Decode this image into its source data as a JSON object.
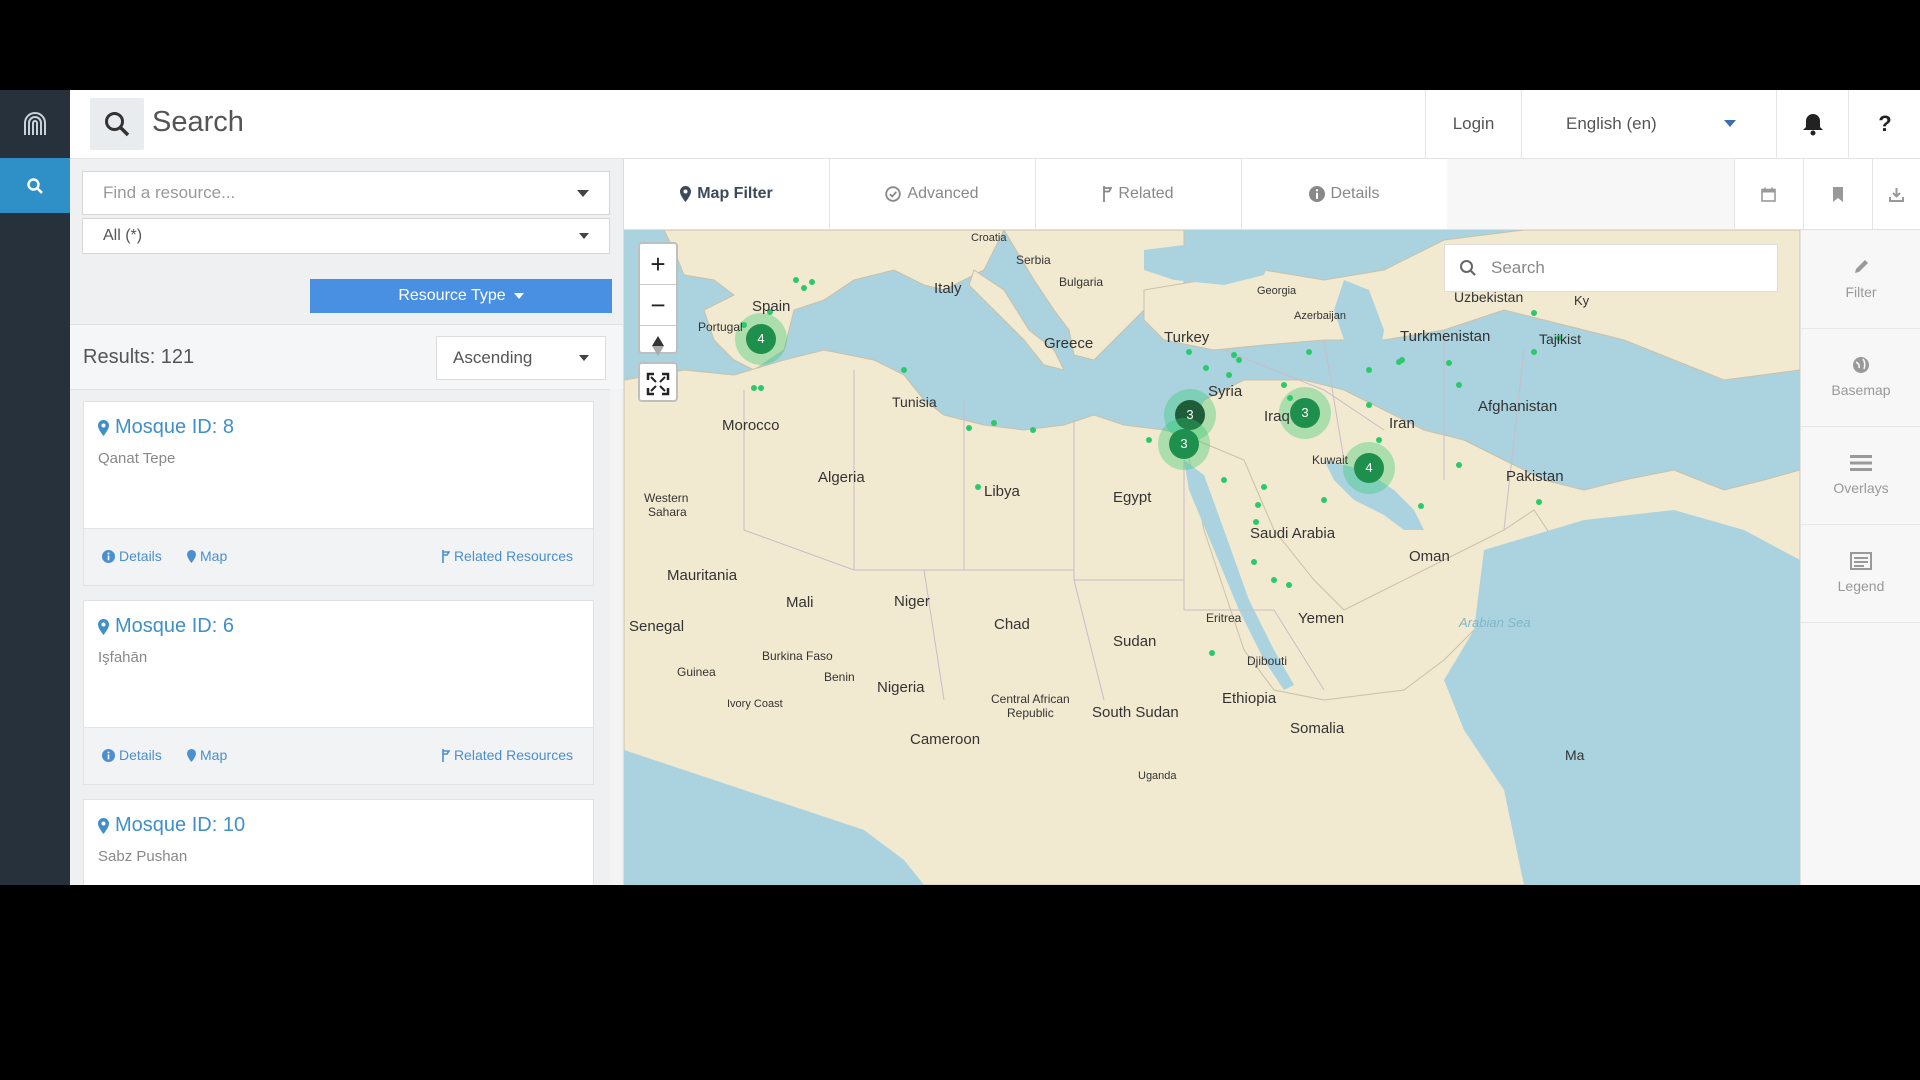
{
  "header": {
    "title": "Search",
    "login": "Login",
    "language": "English (en)",
    "help": "?"
  },
  "search": {
    "placeholder": "Find a resource...",
    "filter_value": "All (*)",
    "resource_type_label": "Resource Type"
  },
  "results": {
    "label": "Results: 121",
    "sort_value": "Ascending",
    "items": [
      {
        "name": "Mosque ID: 8",
        "place": "Qanat Tepe",
        "details": "Details",
        "map": "Map",
        "related": "Related Resources"
      },
      {
        "name": "Mosque ID: 6",
        "place": "Işfahān",
        "details": "Details",
        "map": "Map",
        "related": "Related Resources"
      },
      {
        "name": "Mosque ID: 10",
        "place": "Sabz Pushan"
      }
    ]
  },
  "tabs": [
    {
      "label": "Map Filter",
      "icon": "map-marker-icon"
    },
    {
      "label": "Advanced",
      "icon": "check-circle-icon"
    },
    {
      "label": "Related",
      "icon": "branch-icon"
    },
    {
      "label": "Details",
      "icon": "info-circle-icon"
    }
  ],
  "map": {
    "search_placeholder": "Search",
    "cluster_counts": [
      "4",
      "3",
      "3",
      "3",
      "4"
    ],
    "country_labels": [
      "Spain",
      "Portugal",
      "Italy",
      "Serbia",
      "Bulgaria",
      "Greece",
      "Turkey",
      "Georgia",
      "Azerbaijan",
      "Uzbekistan",
      "Turkmenistan",
      "Tajikist",
      "Ky",
      "Syria",
      "Iraq",
      "Iran",
      "Afghanistan",
      "Kuwait",
      "Pakistan",
      "Tunisia",
      "Morocco",
      "Algeria",
      "Libya",
      "Egypt",
      "Saudi Arabia",
      "Oman",
      "Western Sahara",
      "Mauritania",
      "Mali",
      "Niger",
      "Chad",
      "Sudan",
      "Eritrea",
      "Yemen",
      "Senegal",
      "Burkina Faso",
      "Guinea",
      "Benin",
      "Nigeria",
      "Ivory Coast",
      "Djibouti",
      "Ethiopia",
      "Central African Republic",
      "South Sudan",
      "Somalia",
      "Cameroon",
      "Uganda",
      "Croatia",
      "Arabian Sea",
      "Ma"
    ]
  },
  "right_panel": [
    {
      "label": "Filter",
      "icon": "pencil-icon"
    },
    {
      "label": "Basemap",
      "icon": "globe-icon"
    },
    {
      "label": "Overlays",
      "icon": "list-icon"
    },
    {
      "label": "Legend",
      "icon": "legend-icon"
    }
  ],
  "colors": {
    "rail": "#27313c",
    "accent": "#2f8fc7",
    "link": "#3f8fc9",
    "water": "#aad3df",
    "land": "#f2ead0",
    "cluster": "#2cc96c"
  }
}
